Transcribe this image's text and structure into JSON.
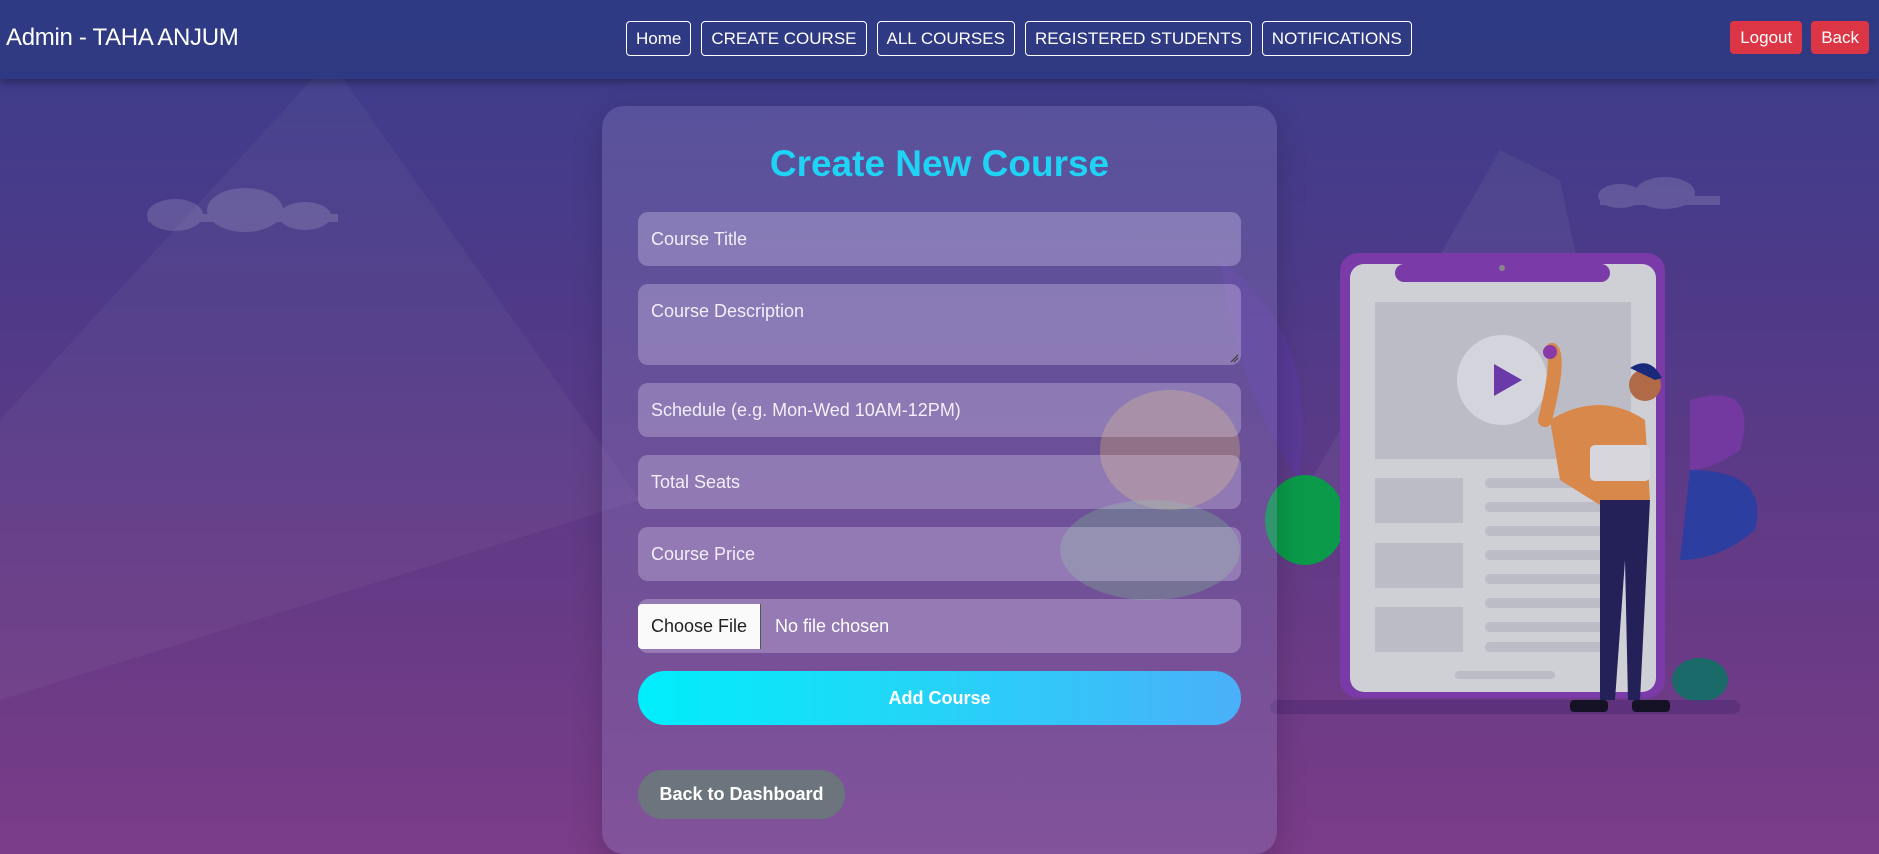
{
  "navbar": {
    "brand": "Admin - TAHA ANJUM",
    "links": [
      "Home",
      "CREATE COURSE",
      "ALL COURSES",
      "REGISTERED STUDENTS",
      "NOTIFICATIONS"
    ],
    "logout_label": "Logout",
    "back_label": "Back"
  },
  "form": {
    "title": "Create New Course",
    "title_color": "#1fd3f5",
    "course_title_placeholder": "Course Title",
    "course_description_placeholder": "Course Description",
    "schedule_placeholder": "Schedule (e.g. Mon-Wed 10AM-12PM)",
    "total_seats_placeholder": "Total Seats",
    "course_price_placeholder": "Course Price",
    "choose_file_label": "Choose File",
    "file_status": "No file chosen",
    "submit_label": "Add Course",
    "back_dashboard_label": "Back to Dashboard"
  },
  "colors": {
    "danger": "#dc3545",
    "secondary": "#6c757d",
    "accent_cyan": "#00eefb"
  },
  "illustration": {
    "icon": "tablet-video-player-illustration"
  }
}
